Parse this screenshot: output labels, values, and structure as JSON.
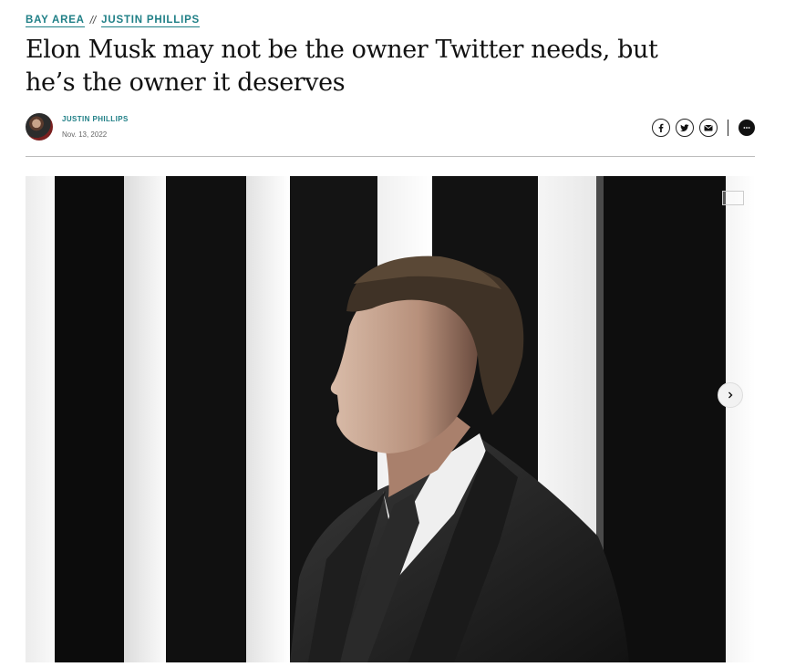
{
  "breadcrumb": {
    "section": "BAY AREA",
    "separator": "//",
    "columnist": "JUSTIN PHILLIPS"
  },
  "headline": "Elon Musk may not be the owner Twitter needs, but he’s the owner it deserves",
  "byline": {
    "author": "JUSTIN PHILLIPS",
    "date": "Nov. 13, 2022"
  },
  "share": {
    "icons": [
      "facebook-icon",
      "twitter-icon",
      "email-icon",
      "comment-icon"
    ]
  },
  "gallery": {
    "next_icon": "chevron-right-icon"
  },
  "colors": {
    "accent": "#1f7f86",
    "text": "#111111",
    "rule": "#bdbdbd"
  }
}
